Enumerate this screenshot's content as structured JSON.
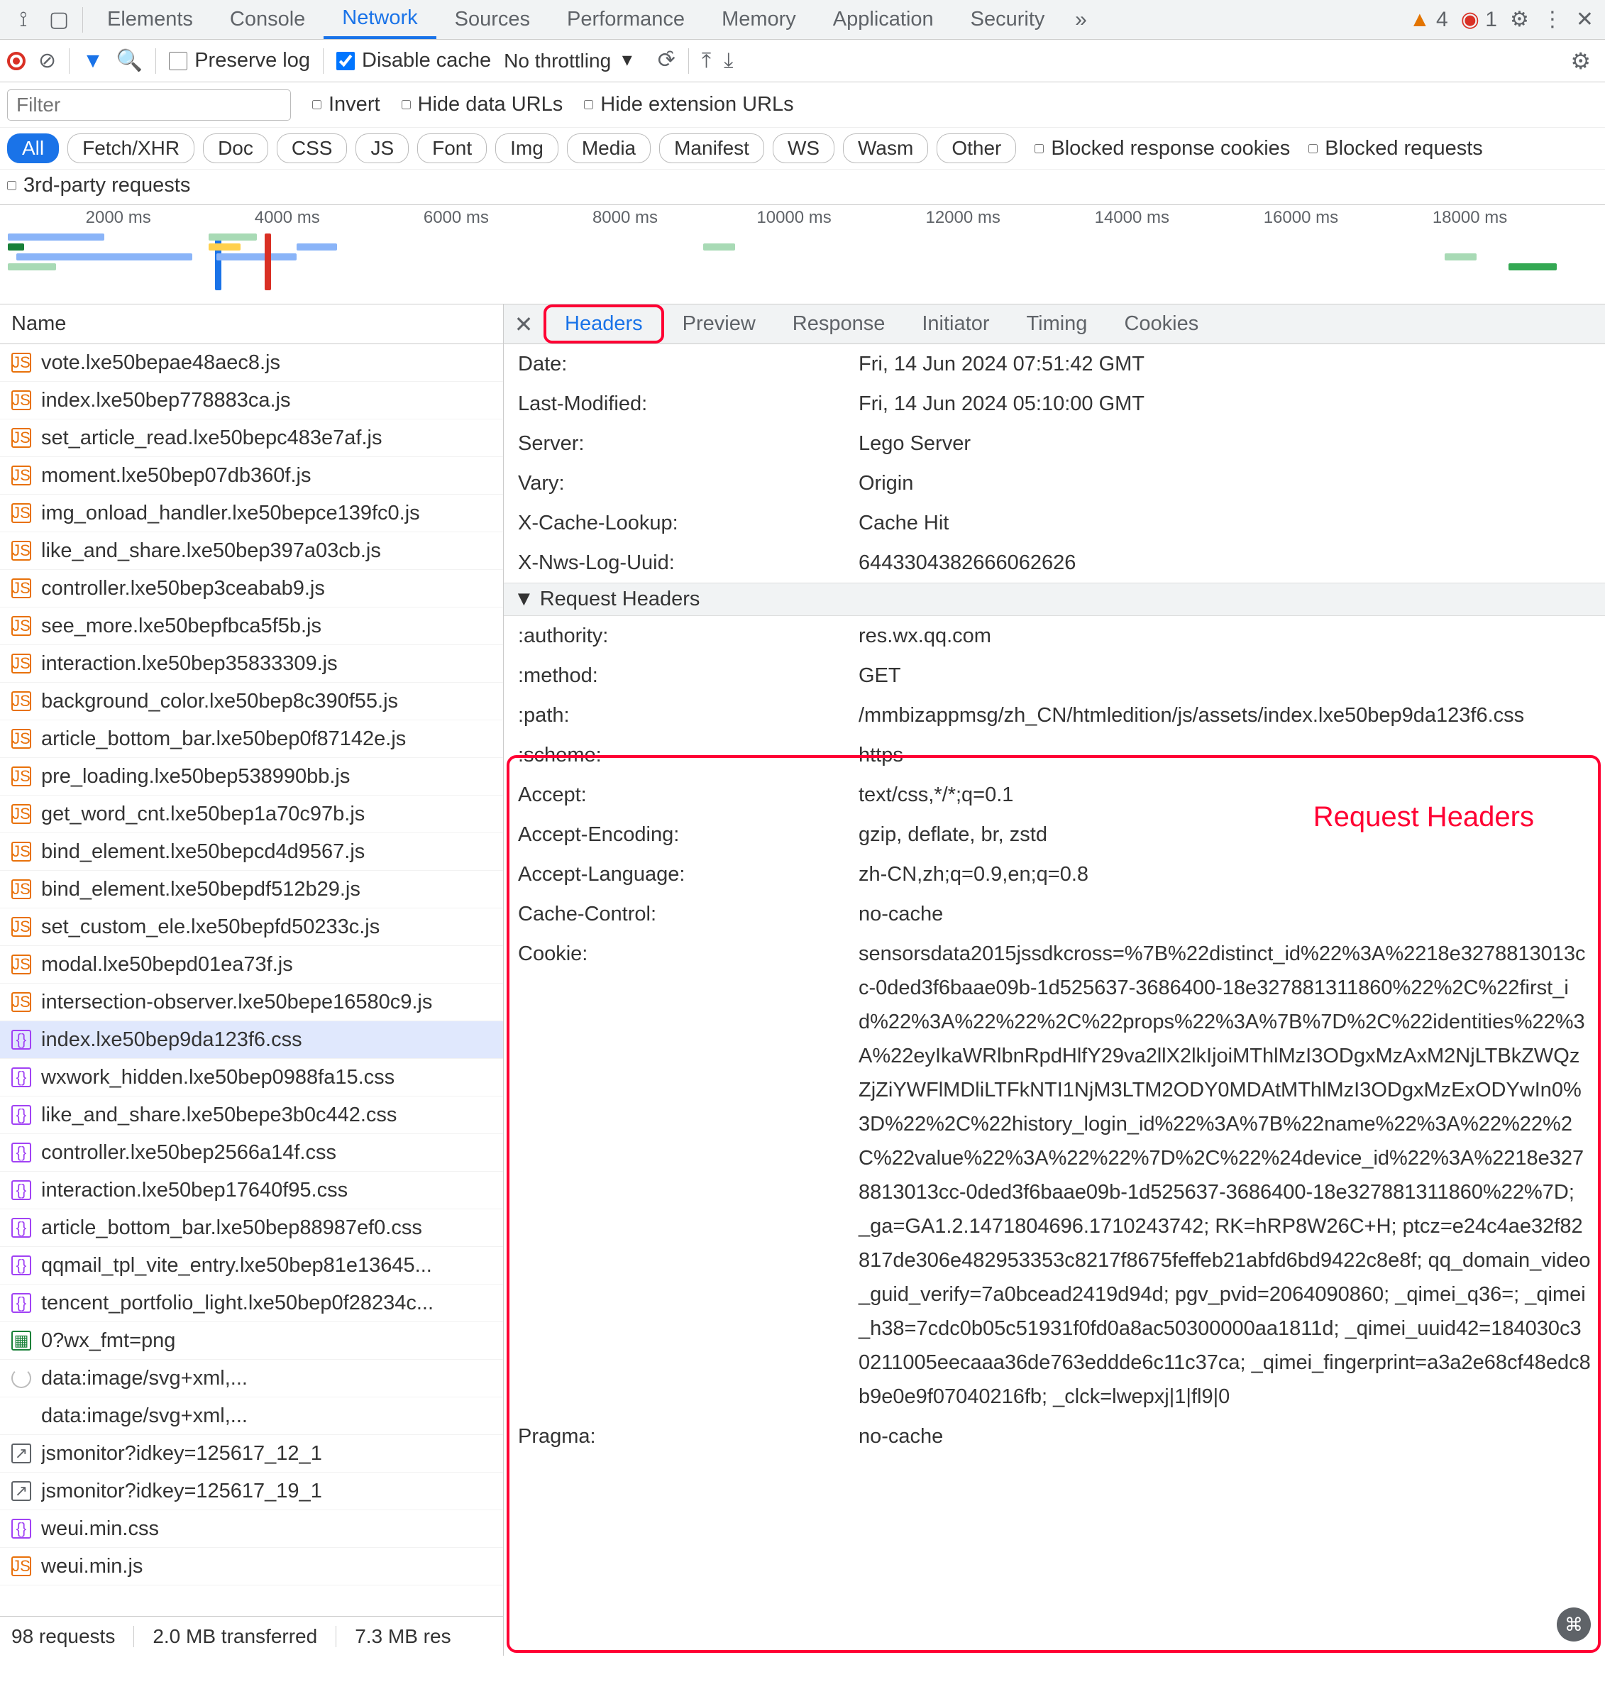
{
  "topTabs": [
    "Elements",
    "Console",
    "Network",
    "Sources",
    "Performance",
    "Memory",
    "Application",
    "Security"
  ],
  "topActive": 2,
  "warningsCount": "4",
  "issuesCount": "1",
  "toolbar": {
    "preserve": "Preserve log",
    "disable": "Disable cache",
    "throttle": "No throttling"
  },
  "filter": {
    "placeholder": "Filter",
    "invert": "Invert",
    "hideData": "Hide data URLs",
    "hideExt": "Hide extension URLs"
  },
  "chips": [
    "All",
    "Fetch/XHR",
    "Doc",
    "CSS",
    "JS",
    "Font",
    "Img",
    "Media",
    "Manifest",
    "WS",
    "Wasm",
    "Other"
  ],
  "chipActive": 0,
  "chipExtras": {
    "blockedCookies": "Blocked response cookies",
    "blockedReq": "Blocked requests",
    "thirdParty": "3rd-party requests"
  },
  "timelineTicks": [
    "2000 ms",
    "4000 ms",
    "6000 ms",
    "8000 ms",
    "10000 ms",
    "12000 ms",
    "14000 ms",
    "16000 ms",
    "18000 ms"
  ],
  "nameHeader": "Name",
  "files": [
    {
      "t": "js",
      "n": "vote.lxe50bepae48aec8.js"
    },
    {
      "t": "js",
      "n": "index.lxe50bep778883ca.js"
    },
    {
      "t": "js",
      "n": "set_article_read.lxe50bepc483e7af.js"
    },
    {
      "t": "js",
      "n": "moment.lxe50bep07db360f.js"
    },
    {
      "t": "js",
      "n": "img_onload_handler.lxe50bepce139fc0.js"
    },
    {
      "t": "js",
      "n": "like_and_share.lxe50bep397a03cb.js"
    },
    {
      "t": "js",
      "n": "controller.lxe50bep3ceabab9.js"
    },
    {
      "t": "js",
      "n": "see_more.lxe50bepfbca5f5b.js"
    },
    {
      "t": "js",
      "n": "interaction.lxe50bep35833309.js"
    },
    {
      "t": "js",
      "n": "background_color.lxe50bep8c390f55.js"
    },
    {
      "t": "js",
      "n": "article_bottom_bar.lxe50bep0f87142e.js"
    },
    {
      "t": "js",
      "n": "pre_loading.lxe50bep538990bb.js"
    },
    {
      "t": "js",
      "n": "get_word_cnt.lxe50bep1a70c97b.js"
    },
    {
      "t": "js",
      "n": "bind_element.lxe50bepcd4d9567.js"
    },
    {
      "t": "js",
      "n": "bind_element.lxe50bepdf512b29.js"
    },
    {
      "t": "js",
      "n": "set_custom_ele.lxe50bepfd50233c.js"
    },
    {
      "t": "js",
      "n": "modal.lxe50bepd01ea73f.js"
    },
    {
      "t": "js",
      "n": "intersection-observer.lxe50bepe16580c9.js"
    },
    {
      "t": "css",
      "n": "index.lxe50bep9da123f6.css",
      "sel": true
    },
    {
      "t": "css",
      "n": "wxwork_hidden.lxe50bep0988fa15.css"
    },
    {
      "t": "css",
      "n": "like_and_share.lxe50bepe3b0c442.css"
    },
    {
      "t": "css",
      "n": "controller.lxe50bep2566a14f.css"
    },
    {
      "t": "css",
      "n": "interaction.lxe50bep17640f95.css"
    },
    {
      "t": "css",
      "n": "article_bottom_bar.lxe50bep88987ef0.css"
    },
    {
      "t": "css",
      "n": "qqmail_tpl_vite_entry.lxe50bep81e13645..."
    },
    {
      "t": "css",
      "n": "tencent_portfolio_light.lxe50bep0f28234c..."
    },
    {
      "t": "img",
      "n": "0?wx_fmt=png"
    },
    {
      "t": "load",
      "n": "data:image/svg+xml,..."
    },
    {
      "t": "none",
      "n": "data:image/svg+xml,..."
    },
    {
      "t": "other",
      "n": "jsmonitor?idkey=125617_12_1"
    },
    {
      "t": "other",
      "n": "jsmonitor?idkey=125617_19_1"
    },
    {
      "t": "css",
      "n": "weui.min.css"
    },
    {
      "t": "js",
      "n": "weui.min.js"
    }
  ],
  "status": {
    "requests": "98 requests",
    "transferred": "2.0 MB transferred",
    "resources": "7.3 MB res"
  },
  "detailTabs": [
    "Headers",
    "Preview",
    "Response",
    "Initiator",
    "Timing",
    "Cookies"
  ],
  "detailActive": 0,
  "responseHeaders": [
    {
      "k": "Date:",
      "v": "Fri, 14 Jun 2024 07:51:42 GMT"
    },
    {
      "k": "Last-Modified:",
      "v": "Fri, 14 Jun 2024 05:10:00 GMT"
    },
    {
      "k": "Server:",
      "v": "Lego Server"
    },
    {
      "k": "Vary:",
      "v": "Origin"
    },
    {
      "k": "X-Cache-Lookup:",
      "v": "Cache Hit"
    },
    {
      "k": "X-Nws-Log-Uuid:",
      "v": "6443304382666062626"
    }
  ],
  "reqSection": "Request Headers",
  "requestHeaders1": [
    {
      "k": ":authority:",
      "v": "res.wx.qq.com"
    },
    {
      "k": ":method:",
      "v": "GET"
    },
    {
      "k": ":path:",
      "v": "/mmbizappmsg/zh_CN/htmledition/js/assets/index.lxe50bep9da123f6.css"
    },
    {
      "k": ":scheme:",
      "v": "https"
    }
  ],
  "requestHeaders2": [
    {
      "k": "Accept:",
      "v": "text/css,*/*;q=0.1"
    },
    {
      "k": "Accept-Encoding:",
      "v": "gzip, deflate, br, zstd"
    },
    {
      "k": "Accept-Language:",
      "v": "zh-CN,zh;q=0.9,en;q=0.8"
    },
    {
      "k": "Cache-Control:",
      "v": "no-cache"
    },
    {
      "k": "Cookie:",
      "v": "sensorsdata2015jssdkcross=%7B%22distinct_id%22%3A%2218e3278813013cc-0ded3f6baae09b-1d525637-3686400-18e327881311860%22%2C%22first_id%22%3A%22%22%2C%22props%22%3A%7B%7D%2C%22identities%22%3A%22eyIkaWRlbnRpdHlfY29va2llX2lkIjoiMThlMzI3ODgxMzAxM2NjLTBkZWQzZjZiYWFlMDliLTFkNTI1NjM3LTM2ODY0MDAtMThlMzI3ODgxMzExODYwIn0%3D%22%2C%22history_login_id%22%3A%7B%22name%22%3A%22%22%2C%22value%22%3A%22%22%7D%2C%22%24device_id%22%3A%2218e3278813013cc-0ded3f6baae09b-1d525637-3686400-18e327881311860%22%7D; _ga=GA1.2.1471804696.1710243742; RK=hRP8W26C+H; ptcz=e24c4ae32f82817de306e482953353c8217f8675feffeb21abfd6bd9422c8e8f; qq_domain_video_guid_verify=7a0bcead2419d94d; pgv_pvid=2064090860; _qimei_q36=; _qimei_h38=7cdc0b05c51931f0fd0a8ac50300000aa1811d; _qimei_uuid42=184030c30211005eecaaa36de763eddde6c11c37ca; _qimei_fingerprint=a3a2e68cf48edc8b9e0e9f07040216fb; _clck=lwepxj|1|fl9|0"
    },
    {
      "k": "Pragma:",
      "v": "no-cache"
    }
  ],
  "annotLabel": "Request Headers"
}
